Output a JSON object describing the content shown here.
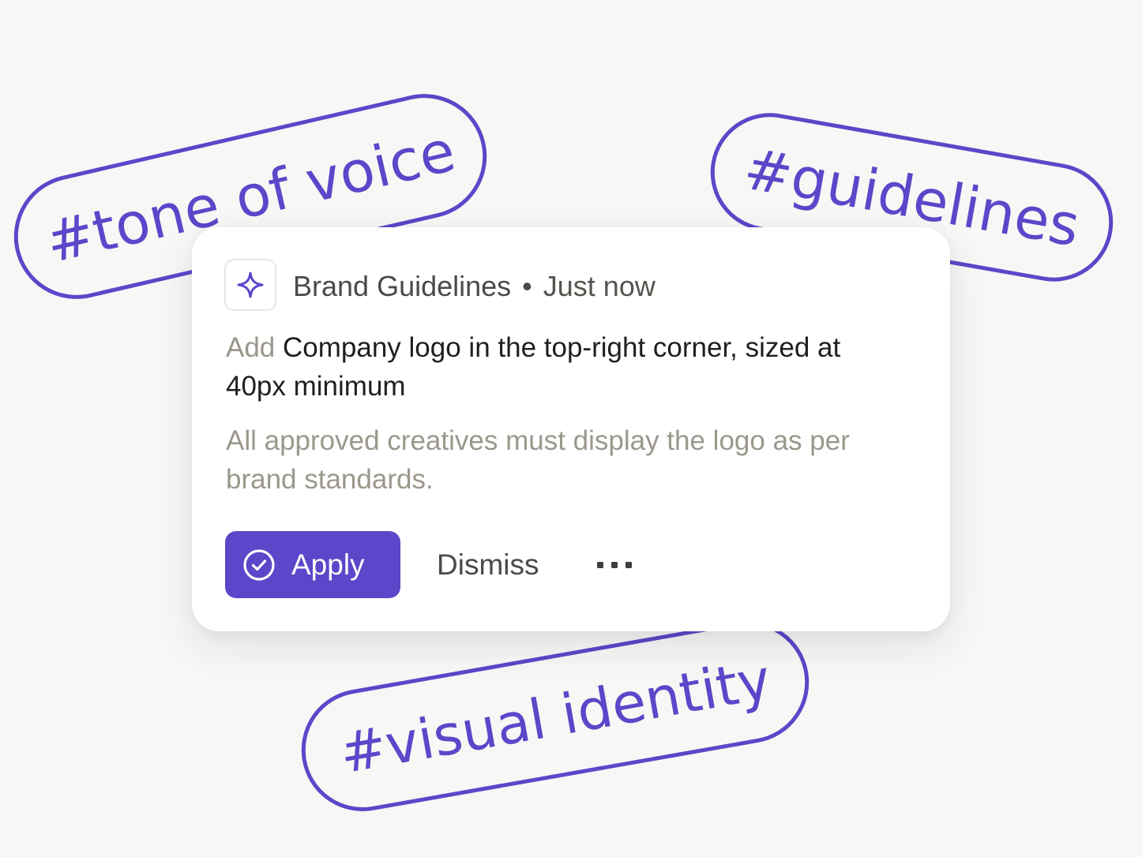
{
  "tags": {
    "tone": "#tone of voice",
    "guidelines": "#guidelines",
    "visual": "#visual identity"
  },
  "card": {
    "source": "Brand Guidelines",
    "separator": "•",
    "time": "Just now",
    "title_verb": "Add",
    "title_rest": "Company logo in the top-right corner, sized at 40px minimum",
    "description": "All approved creatives must display the logo as per brand standards.",
    "apply_label": "Apply",
    "dismiss_label": "Dismiss"
  },
  "icons": {
    "source": "sparkle-icon",
    "apply": "check-circle-icon",
    "more": "more-horizontal-icon"
  },
  "colors": {
    "accent": "#5b47c9",
    "background": "#f7f7f5",
    "card": "#ffffff",
    "muted_text": "#9b978c"
  }
}
